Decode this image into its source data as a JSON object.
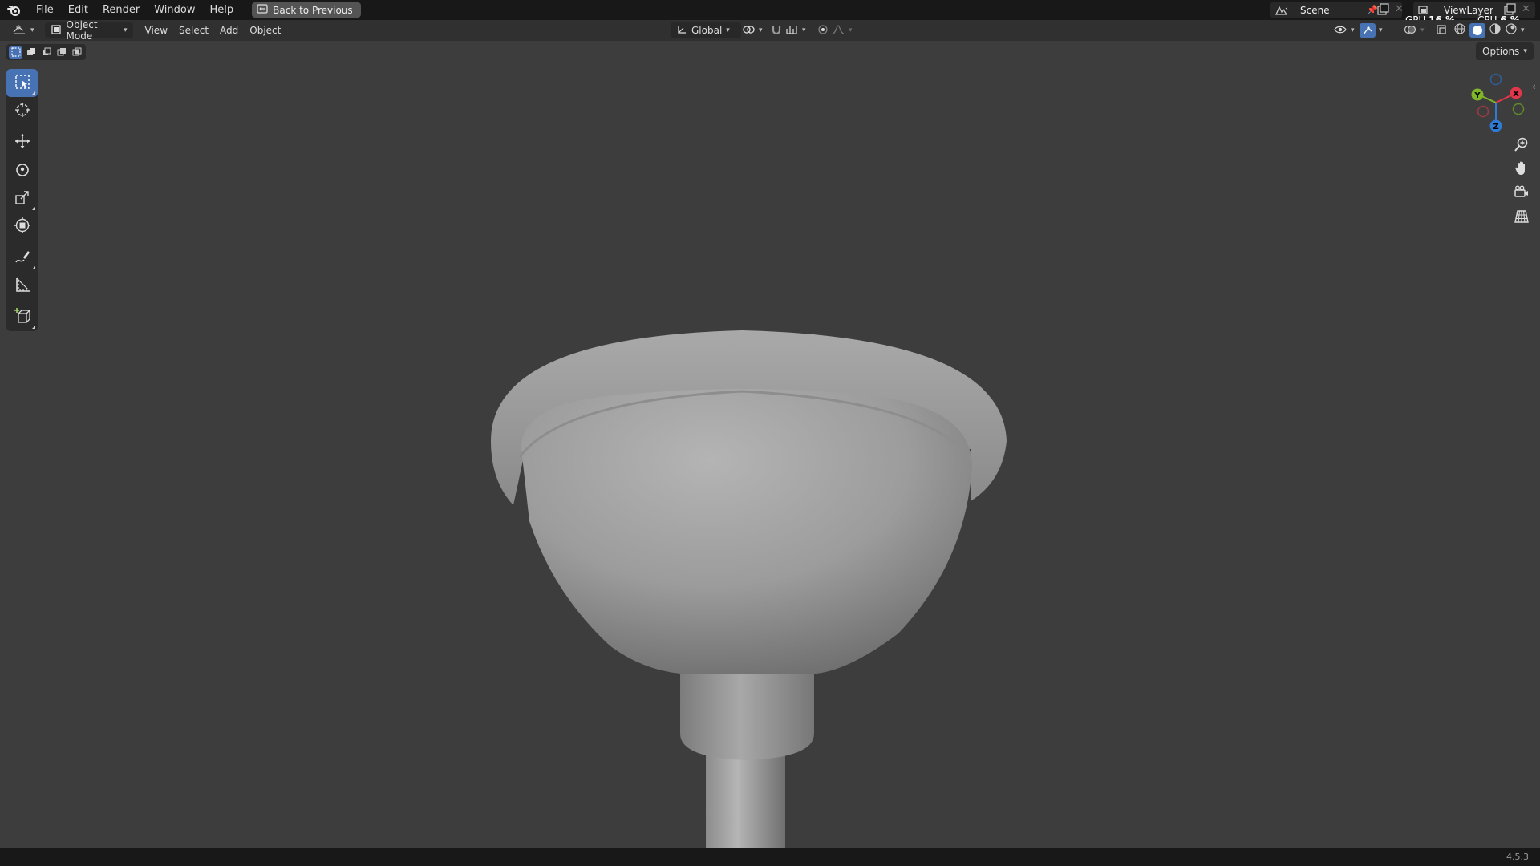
{
  "menu": {
    "file": "File",
    "edit": "Edit",
    "render": "Render",
    "window": "Window",
    "help": "Help",
    "back_to_previous": "Back to Previous"
  },
  "scene": {
    "name": "Scene"
  },
  "view_layer": {
    "name": "ViewLayer"
  },
  "stats": {
    "gpu_label": "GPU",
    "gpu_value": "16 %",
    "cpu_label": "CPU",
    "cpu_value": "6 %"
  },
  "header": {
    "mode": "Object Mode",
    "view": "View",
    "select": "Select",
    "add": "Add",
    "object": "Object",
    "orientation": "Global"
  },
  "options_label": "Options",
  "gizmo": {
    "x": "X",
    "y": "Y",
    "z": "Z"
  },
  "version": "4.5.3",
  "colors": {
    "accent": "#4772b3",
    "axis_x": "#e0384a",
    "axis_y": "#7fb52a",
    "axis_z": "#2f7ad4",
    "viewport_bg": "#3d3d3d"
  }
}
